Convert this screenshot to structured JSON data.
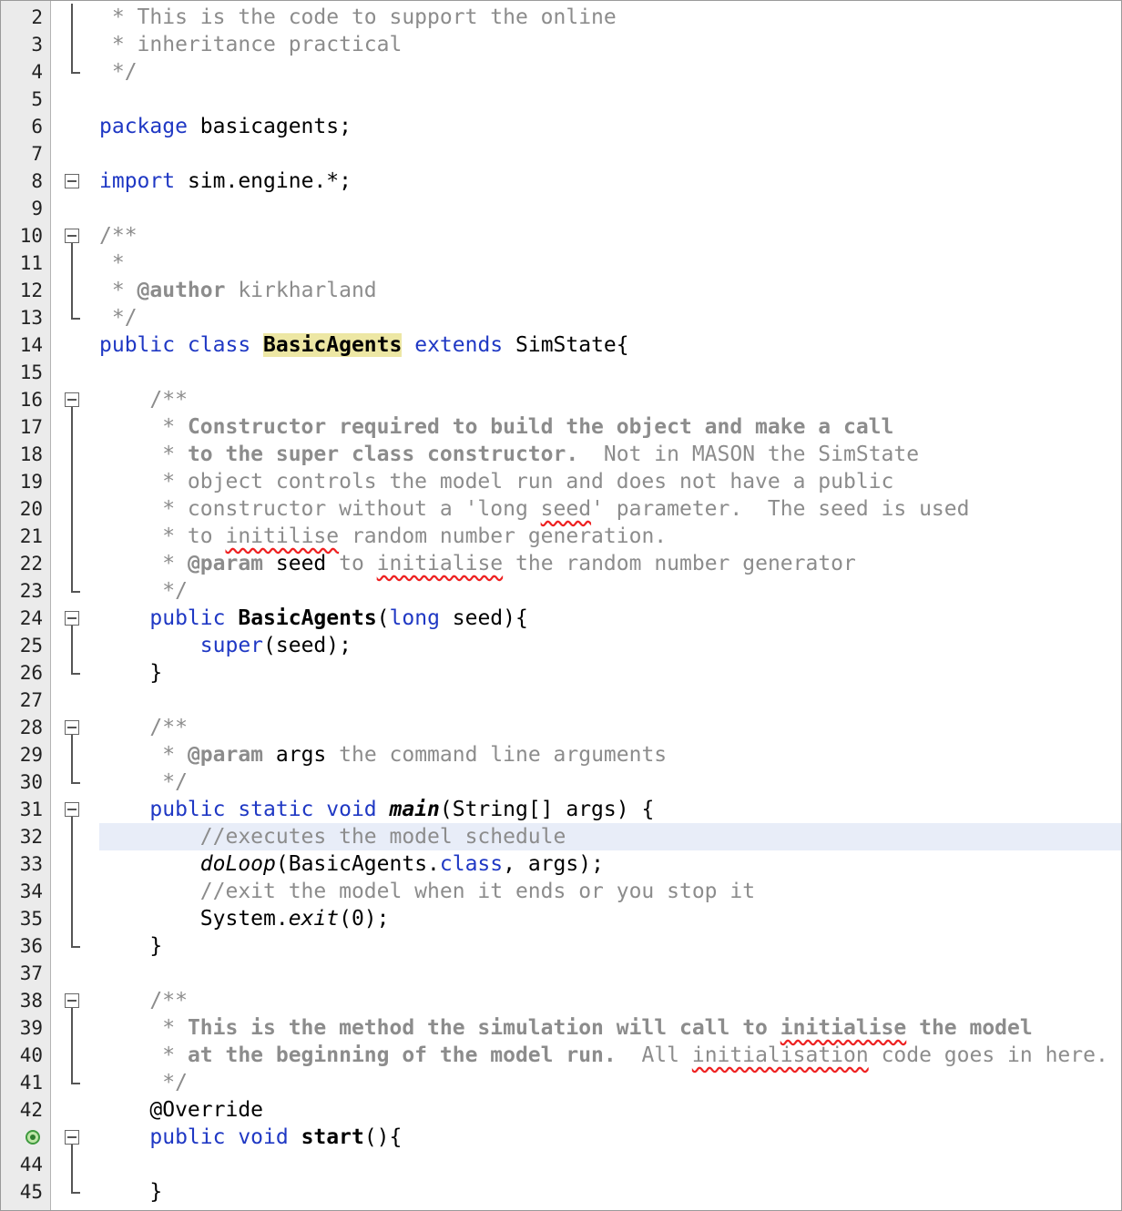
{
  "editor": {
    "current_line": 32,
    "lines": [
      {
        "n": "2",
        "parts": [
          {
            "t": " * This is the code to support the online",
            "c": "cm"
          }
        ]
      },
      {
        "n": "3",
        "parts": [
          {
            "t": " * inheritance practical",
            "c": "cm"
          }
        ]
      },
      {
        "n": "4",
        "parts": [
          {
            "t": " */",
            "c": "cm"
          }
        ]
      },
      {
        "n": "5",
        "parts": []
      },
      {
        "n": "6",
        "parts": [
          {
            "t": "package",
            "c": "kw"
          },
          {
            "t": " basicagents;"
          }
        ]
      },
      {
        "n": "7",
        "parts": []
      },
      {
        "n": "8",
        "parts": [
          {
            "t": "import",
            "c": "kw"
          },
          {
            "t": " sim.engine.*;"
          }
        ]
      },
      {
        "n": "9",
        "parts": []
      },
      {
        "n": "10",
        "parts": [
          {
            "t": "/**",
            "c": "cm"
          }
        ]
      },
      {
        "n": "11",
        "parts": [
          {
            "t": " *",
            "c": "cm"
          }
        ]
      },
      {
        "n": "12",
        "parts": [
          {
            "t": " * ",
            "c": "cm"
          },
          {
            "t": "@author",
            "c": "tag"
          },
          {
            "t": " kirkharland",
            "c": "cm"
          }
        ]
      },
      {
        "n": "13",
        "parts": [
          {
            "t": " */",
            "c": "cm"
          }
        ]
      },
      {
        "n": "14",
        "parts": [
          {
            "t": "public class",
            "c": "kw"
          },
          {
            "t": " "
          },
          {
            "t": "BasicAgents",
            "c": "hl"
          },
          {
            "t": " "
          },
          {
            "t": "extends",
            "c": "kw"
          },
          {
            "t": " SimState{"
          }
        ]
      },
      {
        "n": "15",
        "parts": []
      },
      {
        "n": "16",
        "parts": [
          {
            "t": "    /**",
            "c": "cm"
          }
        ]
      },
      {
        "n": "17",
        "parts": [
          {
            "t": "     * ",
            "c": "cm"
          },
          {
            "t": "Constructor required to build the object and make a call",
            "c": "cmb"
          }
        ]
      },
      {
        "n": "18",
        "parts": [
          {
            "t": "     * ",
            "c": "cm"
          },
          {
            "t": "to the super class constructor.",
            "c": "cmb"
          },
          {
            "t": "  Not in MASON the SimState",
            "c": "cm"
          }
        ]
      },
      {
        "n": "19",
        "parts": [
          {
            "t": "     * object controls the model run and does not have a public",
            "c": "cm"
          }
        ]
      },
      {
        "n": "20",
        "parts": [
          {
            "t": "     * constructor without a 'long ",
            "c": "cm"
          },
          {
            "t": "seed",
            "c": "cm err"
          },
          {
            "t": "' parameter.  The seed is used",
            "c": "cm"
          }
        ]
      },
      {
        "n": "21",
        "parts": [
          {
            "t": "     * to ",
            "c": "cm"
          },
          {
            "t": "initilise",
            "c": "cm err"
          },
          {
            "t": " random number generation.",
            "c": "cm"
          }
        ]
      },
      {
        "n": "22",
        "parts": [
          {
            "t": "     * ",
            "c": "cm"
          },
          {
            "t": "@param",
            "c": "tag"
          },
          {
            "t": " seed"
          },
          {
            "t": " to ",
            "c": "cm"
          },
          {
            "t": "initialise",
            "c": "cm err"
          },
          {
            "t": " the random number generator",
            "c": "cm"
          }
        ]
      },
      {
        "n": "23",
        "parts": [
          {
            "t": "     */",
            "c": "cm"
          }
        ]
      },
      {
        "n": "24",
        "parts": [
          {
            "t": "    "
          },
          {
            "t": "public",
            "c": "kw"
          },
          {
            "t": " "
          },
          {
            "t": "BasicAgents",
            "c": "bd"
          },
          {
            "t": "("
          },
          {
            "t": "long",
            "c": "kw"
          },
          {
            "t": " seed){"
          }
        ]
      },
      {
        "n": "25",
        "parts": [
          {
            "t": "        "
          },
          {
            "t": "super",
            "c": "kw"
          },
          {
            "t": "(seed);"
          }
        ]
      },
      {
        "n": "26",
        "parts": [
          {
            "t": "    }"
          }
        ]
      },
      {
        "n": "27",
        "parts": []
      },
      {
        "n": "28",
        "parts": [
          {
            "t": "    /**",
            "c": "cm"
          }
        ]
      },
      {
        "n": "29",
        "parts": [
          {
            "t": "     * ",
            "c": "cm"
          },
          {
            "t": "@param",
            "c": "tag"
          },
          {
            "t": " args"
          },
          {
            "t": " the command line arguments",
            "c": "cm"
          }
        ]
      },
      {
        "n": "30",
        "parts": [
          {
            "t": "     */",
            "c": "cm"
          }
        ]
      },
      {
        "n": "31",
        "parts": [
          {
            "t": "    "
          },
          {
            "t": "public static void",
            "c": "kw"
          },
          {
            "t": " "
          },
          {
            "t": "main",
            "c": "bi"
          },
          {
            "t": "(String[] args) {"
          }
        ]
      },
      {
        "n": "32",
        "parts": [
          {
            "t": "        //executes the model schedule",
            "c": "cm"
          }
        ]
      },
      {
        "n": "33",
        "parts": [
          {
            "t": "        "
          },
          {
            "t": "doLoop",
            "c": "it"
          },
          {
            "t": "(BasicAgents."
          },
          {
            "t": "class",
            "c": "kw"
          },
          {
            "t": ", args);"
          }
        ]
      },
      {
        "n": "34",
        "parts": [
          {
            "t": "        //exit the model when it ends or you stop it",
            "c": "cm"
          }
        ]
      },
      {
        "n": "35",
        "parts": [
          {
            "t": "        System."
          },
          {
            "t": "exit",
            "c": "it"
          },
          {
            "t": "(0);"
          }
        ]
      },
      {
        "n": "36",
        "parts": [
          {
            "t": "    }"
          }
        ]
      },
      {
        "n": "37",
        "parts": []
      },
      {
        "n": "38",
        "parts": [
          {
            "t": "    /**",
            "c": "cm"
          }
        ]
      },
      {
        "n": "39",
        "parts": [
          {
            "t": "     * ",
            "c": "cm"
          },
          {
            "t": "This is the method the simulation will call to ",
            "c": "cmb"
          },
          {
            "t": "initialise",
            "c": "cmb err"
          },
          {
            "t": " the model",
            "c": "cmb"
          }
        ]
      },
      {
        "n": "40",
        "parts": [
          {
            "t": "     * ",
            "c": "cm"
          },
          {
            "t": "at the beginning of the model run.",
            "c": "cmb"
          },
          {
            "t": "  All ",
            "c": "cm"
          },
          {
            "t": "initialisation",
            "c": "cm err"
          },
          {
            "t": " code goes in here.",
            "c": "cm"
          }
        ]
      },
      {
        "n": "41",
        "parts": [
          {
            "t": "     */",
            "c": "cm"
          }
        ]
      },
      {
        "n": "42",
        "parts": [
          {
            "t": "    @Override"
          }
        ]
      },
      {
        "n": "43",
        "parts": [
          {
            "t": "    "
          },
          {
            "t": "public void",
            "c": "kw"
          },
          {
            "t": " "
          },
          {
            "t": "start",
            "c": "bd"
          },
          {
            "t": "(){"
          }
        ]
      },
      {
        "n": "44",
        "parts": []
      },
      {
        "n": "45",
        "parts": [
          {
            "t": "    }"
          }
        ]
      }
    ],
    "gutter_marker": {
      "line": "43",
      "icon": "override-marker-icon"
    },
    "folds": [
      {
        "start": "2",
        "end": "4",
        "box": false
      },
      {
        "start": "8",
        "end": "8",
        "box": true
      },
      {
        "start": "10",
        "end": "13",
        "box": true
      },
      {
        "start": "16",
        "end": "23",
        "box": true
      },
      {
        "start": "24",
        "end": "26",
        "box": true
      },
      {
        "start": "28",
        "end": "30",
        "box": true
      },
      {
        "start": "31",
        "end": "36",
        "box": true
      },
      {
        "start": "38",
        "end": "41",
        "box": true
      },
      {
        "start": "43",
        "end": "45",
        "box": true
      }
    ]
  }
}
